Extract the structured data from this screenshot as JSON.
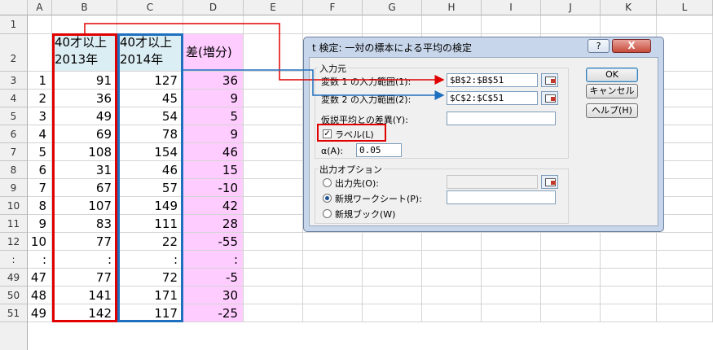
{
  "columns": [
    "A",
    "B",
    "C",
    "D",
    "E",
    "F",
    "G",
    "H",
    "I",
    "J",
    "K",
    "L"
  ],
  "row_numbers": [
    "1",
    "2",
    "3",
    "4",
    "5",
    "6",
    "7",
    "8",
    "9",
    "10",
    "11",
    "12",
    ":",
    "49",
    "50",
    "51"
  ],
  "headers": {
    "b_line1": "40才以上",
    "b_line2": "2013年",
    "c_line1": "40才以上",
    "c_line2": "2014年",
    "d": "差(増分)"
  },
  "rows": [
    {
      "a": "1",
      "b": "91",
      "c": "127",
      "d": "36"
    },
    {
      "a": "2",
      "b": "36",
      "c": "45",
      "d": "9"
    },
    {
      "a": "3",
      "b": "49",
      "c": "54",
      "d": "5"
    },
    {
      "a": "4",
      "b": "69",
      "c": "78",
      "d": "9"
    },
    {
      "a": "5",
      "b": "108",
      "c": "154",
      "d": "46"
    },
    {
      "a": "6",
      "b": "31",
      "c": "46",
      "d": "15"
    },
    {
      "a": "7",
      "b": "67",
      "c": "57",
      "d": "-10"
    },
    {
      "a": "8",
      "b": "107",
      "c": "149",
      "d": "42"
    },
    {
      "a": "9",
      "b": "83",
      "c": "111",
      "d": "28"
    },
    {
      "a": "10",
      "b": "77",
      "c": "22",
      "d": "-55"
    },
    {
      "a": ":",
      "b": ":",
      "c": ":",
      "d": ":"
    },
    {
      "a": "47",
      "b": "77",
      "c": "72",
      "d": "-5"
    },
    {
      "a": "48",
      "b": "141",
      "c": "171",
      "d": "30"
    },
    {
      "a": "49",
      "b": "142",
      "c": "117",
      "d": "-25"
    }
  ],
  "dialog": {
    "title": "t 検定: 一対の標本による平均の検定",
    "help_glyph": "?",
    "close_glyph": "X",
    "input_group": "入力元",
    "var1_label": "変数 1 の入力範囲(1):",
    "var1_value": "$B$2:$B$51",
    "var2_label": "変数 2 の入力範囲(2):",
    "var2_value": "$C$2:$C$51",
    "hyp_label": "仮説平均との差異(Y):",
    "hyp_value": "",
    "label_checkbox": "ラベル(L)",
    "label_checked_glyph": "✓",
    "alpha_label": "α(A):",
    "alpha_value": "0.05",
    "output_group": "出力オプション",
    "out_range": "出力先(O):",
    "out_range_value": "",
    "new_sheet": "新規ワークシート(P):",
    "new_sheet_value": "",
    "new_book": "新規ブック(W)",
    "ok": "OK",
    "cancel": "キャンセル",
    "help": "ヘルプ(H)"
  },
  "colors": {
    "highlight_red": "#e00000",
    "highlight_blue": "#1f6fbf",
    "diff_fill": "#ffccff",
    "dialog_frame": "#c7d6ea"
  }
}
